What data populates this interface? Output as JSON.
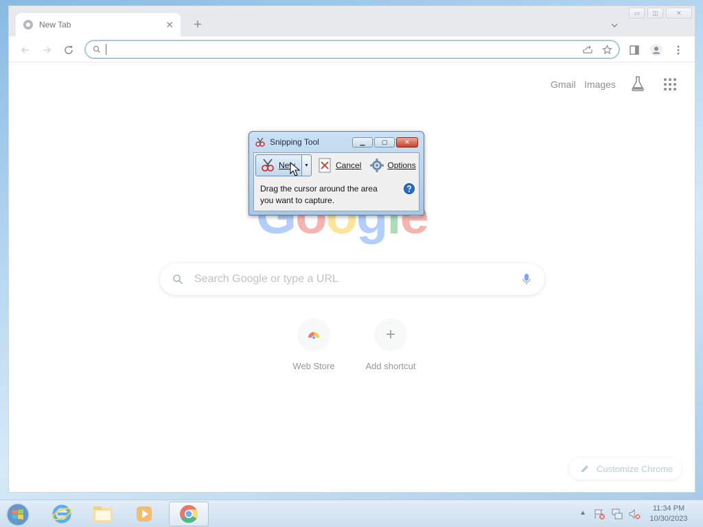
{
  "browser": {
    "tab": {
      "title": "New Tab",
      "close_glyph": "✕"
    },
    "new_tab_glyph": "+",
    "tab_search_glyph": "⌄",
    "window_controls": {
      "minimize": "▭",
      "restore": "◫",
      "close": "✕"
    },
    "omnibox": {
      "value": "",
      "placeholder": ""
    },
    "icons": [
      "back-arrow-icon",
      "forward-arrow-icon",
      "reload-icon",
      "search-icon",
      "share-icon",
      "star-icon",
      "side-panel-icon",
      "profile-icon",
      "menu-dots-icon"
    ]
  },
  "ntp": {
    "links": {
      "gmail": "Gmail",
      "images": "Images"
    },
    "logo": {
      "letters": [
        "G",
        "o",
        "o",
        "g",
        "l",
        "e"
      ],
      "colors": [
        "#4285f4",
        "#ea4335",
        "#fbbc05",
        "#4285f4",
        "#34a853",
        "#ea4335"
      ]
    },
    "search_placeholder": "Search Google or type a URL",
    "shortcuts": [
      {
        "label": "Web Store"
      },
      {
        "label": "Add shortcut",
        "glyph": "+"
      }
    ],
    "customize_label": "Customize Chrome"
  },
  "snipping_tool": {
    "title": "Snipping Tool",
    "new_label": "New",
    "cancel_label": "Cancel",
    "options_label": "Options",
    "hint_line1": "Drag the cursor around the area",
    "hint_line2": "you want to capture.",
    "wbtn_min": "▁",
    "wbtn_max": "▢",
    "wbtn_close": "✕",
    "dropdown_glyph": "▼"
  },
  "taskbar": {
    "apps": [
      "internet-explorer",
      "file-explorer",
      "media-player",
      "google-chrome"
    ],
    "tray_chevron": "▲",
    "clock_time": "11:34 PM",
    "clock_date": "10/30/2023"
  }
}
